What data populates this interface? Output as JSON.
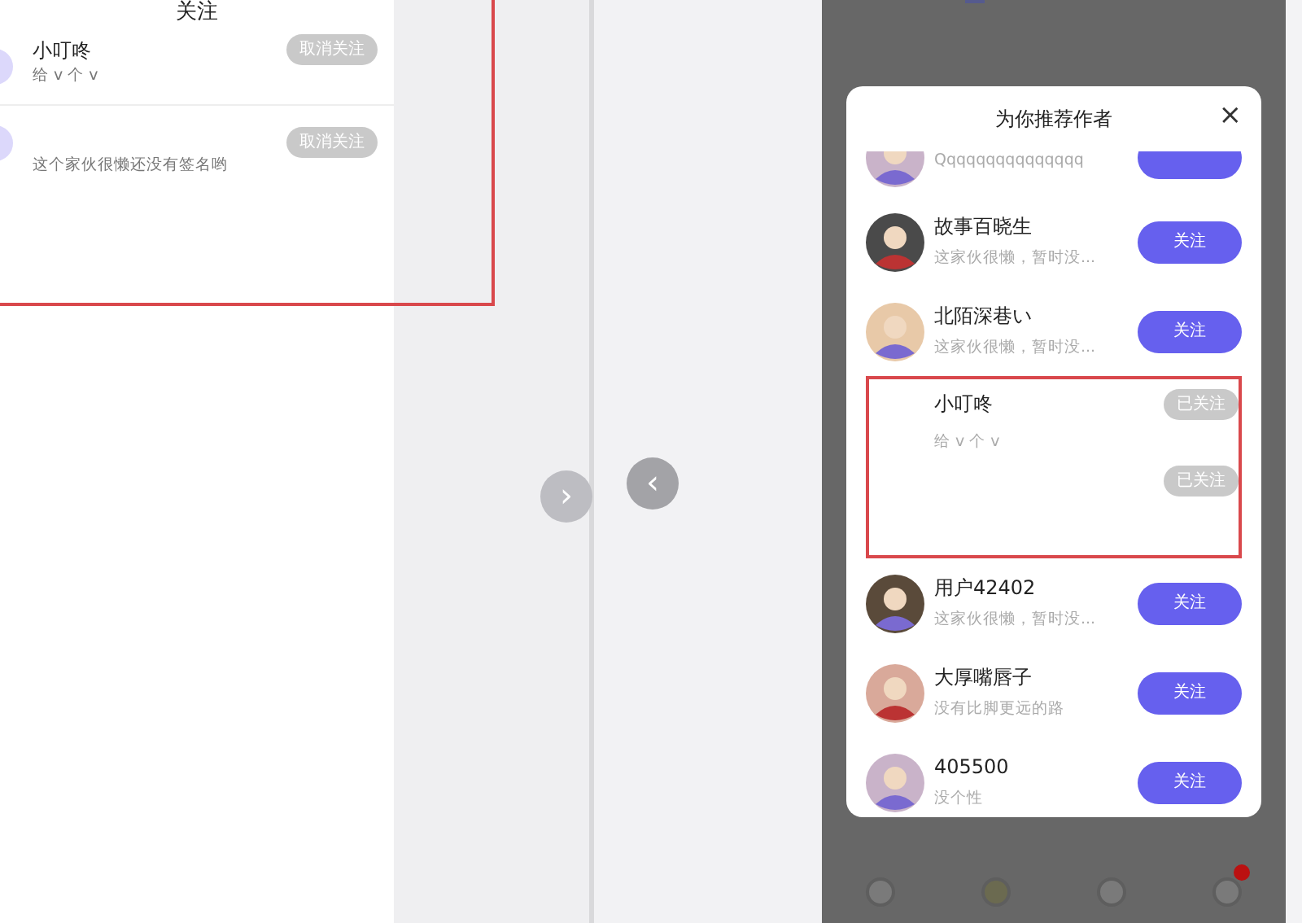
{
  "left_panel": {
    "title": "关注",
    "rows": [
      {
        "name": "小叮咚",
        "bio": "给 v 个 v",
        "button": "取消关注"
      },
      {
        "bio": "这个家伙很懒还没有签名哟",
        "button": "取消关注"
      }
    ]
  },
  "nav_arrows": [
    {
      "symbol": "›",
      "active": false
    },
    {
      "symbol": "‹",
      "active": true
    }
  ],
  "modal": {
    "title": "为你推荐作者",
    "close": "×",
    "rows": [
      {
        "kind": "user",
        "bio": "Qqqqqqqqqqqqqqq",
        "followed": false,
        "avatar": true
      },
      {
        "kind": "user",
        "name": "故事百晓生",
        "bio": "这家伙很懒，暂时没...",
        "button": "关注",
        "followed": false,
        "avatar": true
      },
      {
        "kind": "user",
        "name": "北陌深巷い",
        "bio": "这家伙很懒，暂时没...",
        "button": "关注",
        "followed": false,
        "avatar": true
      },
      {
        "kind": "marked",
        "name": "小叮咚",
        "bio": "给 v 个 v",
        "buttons": [
          {
            "label": "已关注",
            "followed": true
          },
          {
            "label": "已关注",
            "followed": true
          }
        ]
      },
      {
        "kind": "user",
        "name": "用户42402",
        "bio": "这家伙很懒，暂时没...",
        "button": "关注",
        "followed": false,
        "avatar": true
      },
      {
        "kind": "user",
        "name": "大厚嘴唇子",
        "bio": "没有比脚更远的路",
        "button": "关注",
        "followed": false,
        "avatar": true
      },
      {
        "kind": "user",
        "name": "405500",
        "bio": "没个性",
        "button": "关注",
        "followed": false,
        "avatar": true
      }
    ]
  },
  "bottom_nav": [
    {
      "badge": false
    },
    {
      "badge": false
    },
    {
      "badge": false
    },
    {
      "badge": true
    }
  ]
}
